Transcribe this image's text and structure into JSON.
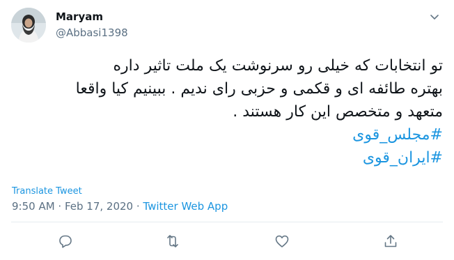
{
  "user": {
    "name": "Maryam",
    "handle": "@Abbasi1398"
  },
  "tweet": {
    "lines": [
      "تو انتخابات که  خیلی رو سرنوشت یک ملت تاثیر داره",
      "بهتره طائفه ای و قکمی و حزبی رای ندیم . ببینیم کیا واقعا",
      "متعهد و متخصص این کار هستند ."
    ],
    "hashtags": [
      "#مجلس_قوی",
      "#ایران_قوی"
    ]
  },
  "translate_label": "Translate Tweet",
  "meta": {
    "time": "9:50 AM",
    "separator1": " · ",
    "date": "Feb 17, 2020",
    "separator2": " · ",
    "app": "Twitter Web App"
  },
  "colors": {
    "accent": "#1b95e0",
    "secondary_text": "#5b7083",
    "primary_text": "#0f1419",
    "icon": "#657786"
  },
  "icons": {
    "menu": "chevron-down-icon",
    "reply": "reply-icon",
    "retweet": "retweet-icon",
    "like": "heart-icon",
    "share": "share-icon"
  }
}
